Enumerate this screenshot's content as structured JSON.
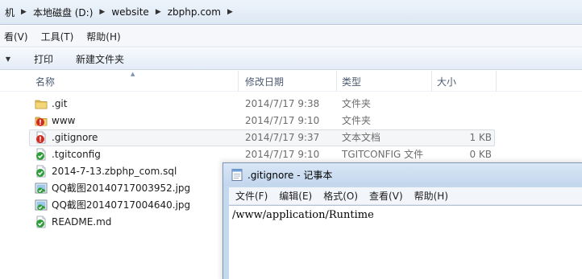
{
  "address": {
    "crumbs": [
      "机",
      "本地磁盘 (D:)",
      "website",
      "zbphp.com"
    ]
  },
  "menubar": {
    "items": [
      "看(V)",
      "工具(T)",
      "帮助(H)"
    ]
  },
  "toolbar": {
    "print_label": "打印",
    "new_folder_label": "新建文件夹"
  },
  "columns": {
    "name": "名称",
    "date": "修改日期",
    "type": "类型",
    "size": "大小"
  },
  "files": [
    {
      "name": ".git",
      "date": "2014/7/17 9:38",
      "type": "文件夹",
      "size": "",
      "icon": "folder-icon"
    },
    {
      "name": "www",
      "date": "2014/7/17 9:10",
      "type": "文件夹",
      "size": "",
      "icon": "git-modified-icon"
    },
    {
      "name": ".gitignore",
      "date": "2014/7/17 9:37",
      "type": "文本文档",
      "size": "1 KB",
      "icon": "git-modified-icon"
    },
    {
      "name": ".tgitconfig",
      "date": "2014/7/17 9:10",
      "type": "TGITCONFIG 文件",
      "size": "0 KB",
      "icon": "git-ok-icon"
    },
    {
      "name": "2014-7-13.zbphp_com.sql",
      "date": "",
      "type": "",
      "size": "",
      "icon": "git-ok-icon"
    },
    {
      "name": "QQ截图20140717003952.jpg",
      "date": "",
      "type": "",
      "size": "",
      "icon": "image-icon"
    },
    {
      "name": "QQ截图20140717004640.jpg",
      "date": "",
      "type": "",
      "size": "",
      "icon": "image-icon"
    },
    {
      "name": "README.md",
      "date": "",
      "type": "",
      "size": "",
      "icon": "git-ok-icon"
    }
  ],
  "notepad": {
    "title": ".gitignore - 记事本",
    "menus": [
      "文件(F)",
      "编辑(E)",
      "格式(O)",
      "查看(V)",
      "帮助(H)"
    ],
    "content": "/www/application/Runtime"
  },
  "colors": {
    "folder": "#e8c15a",
    "git_ok": "#2e9e3a",
    "git_modified": "#d6281e",
    "selection": "#f5f6f8"
  }
}
